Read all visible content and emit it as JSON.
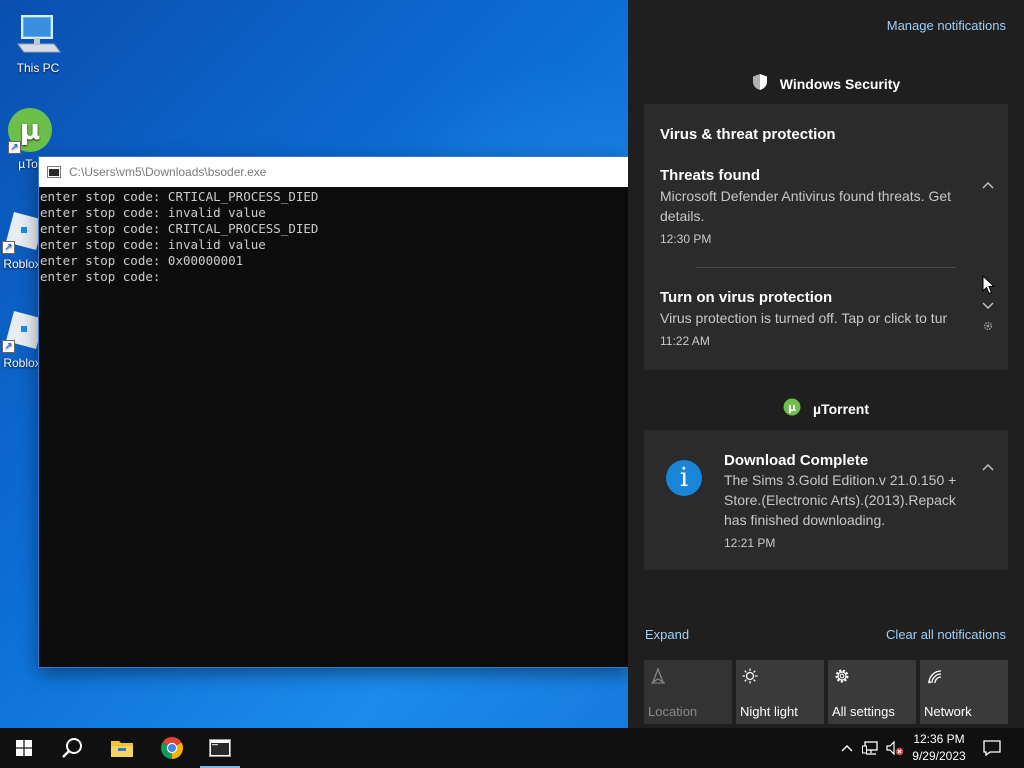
{
  "desktop": {
    "icons": [
      {
        "label": "This PC",
        "icon": "computer-icon"
      },
      {
        "label": "µTor",
        "icon": "utorrent-icon"
      },
      {
        "label": "Roblox",
        "icon": "roblox-icon"
      },
      {
        "label": "Roblox",
        "icon": "roblox-icon"
      }
    ]
  },
  "console": {
    "title": "C:\\Users\\vm5\\Downloads\\bsoder.exe",
    "lines": [
      "enter stop code: CRTICAL_PROCESS_DIED",
      "enter stop code: invalid value",
      "enter stop code: CRITCAL_PROCESS_DIED",
      "enter stop code: invalid value",
      "enter stop code: 0x00000001",
      "enter stop code:"
    ]
  },
  "action_center": {
    "manage_label": "Manage notifications",
    "groups": [
      {
        "app": "Windows Security",
        "section_title": "Virus & threat protection",
        "notifications": [
          {
            "title": "Threats found",
            "body": "Microsoft Defender Antivirus found threats. Get details.",
            "time": "12:30 PM"
          },
          {
            "title": "Turn on virus protection",
            "body": "Virus protection is turned off. Tap or click to tur",
            "time": "11:22 AM"
          }
        ]
      },
      {
        "app": "µTorrent",
        "notifications": [
          {
            "title": "Download Complete",
            "body": "The Sims 3.Gold Edition.v 21.0.150 + Store.(Electronic Arts).(2013).Repack has finished downloading.",
            "time": "12:21 PM"
          }
        ]
      }
    ],
    "expand_label": "Expand",
    "clear_label": "Clear all notifications",
    "quick_actions": [
      {
        "label": "Location",
        "icon": "location-icon",
        "enabled": false
      },
      {
        "label": "Night light",
        "icon": "night-light-icon",
        "enabled": true
      },
      {
        "label": "All settings",
        "icon": "settings-icon",
        "enabled": true
      },
      {
        "label": "Network",
        "icon": "network-icon",
        "enabled": true
      }
    ]
  },
  "taskbar": {
    "apps": [
      "start-icon",
      "search-icon",
      "file-explorer-icon",
      "chrome-icon",
      "console-app-icon"
    ],
    "clock": {
      "time": "12:36 PM",
      "date": "9/29/2023"
    }
  },
  "colors": {
    "accent": "#1a86d8",
    "link": "#9fd0f5",
    "panel": "#1f1f1f",
    "card": "#2b2b2b"
  }
}
